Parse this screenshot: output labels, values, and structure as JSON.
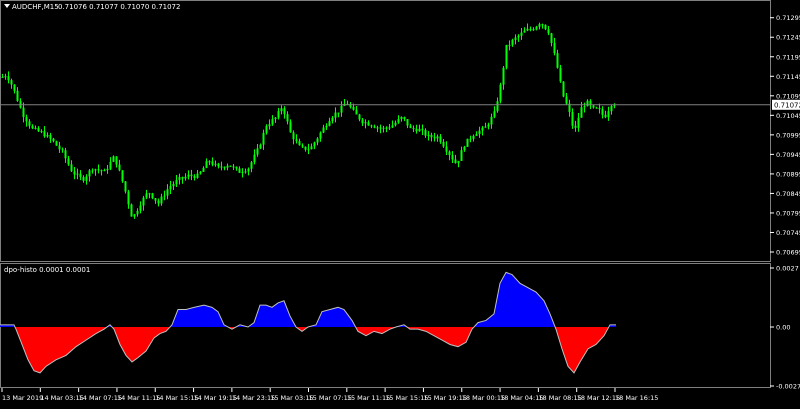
{
  "main_panel": {
    "symbol_label": "AUDCHF,M15",
    "ohlc_label": "0.71076 0.71077 0.71070 0.71072",
    "current_price": 0.71072,
    "price_tag": "0.71072",
    "y_range": [
      0.70695,
      0.71325
    ],
    "y_ticks": [
      "0.71295",
      "0.71245",
      "0.71195",
      "0.71145",
      "0.71095",
      "0.71045",
      "0.70995",
      "0.70945",
      "0.70895",
      "0.70845",
      "0.70795",
      "0.70745",
      "0.70695"
    ]
  },
  "indicator_panel": {
    "label": "dpo-histo 0.0001 0.0001",
    "y_ticks": [
      "0.0027",
      "0.00",
      "-0.0027"
    ],
    "y_range": [
      -0.0027,
      0.0027
    ],
    "positive_color": "#0000ff",
    "negative_color": "#ff0000",
    "line_color": "#c0c0c0"
  },
  "x_axis": {
    "labels": [
      "13 Mar 2019",
      "14 Mar 03:15",
      "14 Mar 07:15",
      "14 Mar 11:15",
      "14 Mar 15:15",
      "14 Mar 19:15",
      "14 Mar 23:15",
      "15 Mar 03:15",
      "15 Mar 07:15",
      "15 Mar 11:15",
      "15 Mar 15:15",
      "15 Mar 19:15",
      "18 Mar 00:15",
      "18 Mar 04:15",
      "18 Mar 08:15",
      "18 Mar 12:15",
      "18 Mar 16:15"
    ]
  },
  "colors": {
    "background": "#000000",
    "candle": "#00ff00",
    "axis_text": "#ffffff",
    "grid_line": "#808080"
  },
  "chart_data": [
    {
      "type": "candlestick",
      "title": "AUDCHF,M15",
      "ylim": [
        0.70695,
        0.71325
      ],
      "close_path": [
        [
          0,
          0.7114
        ],
        [
          6,
          0.7115
        ],
        [
          12,
          0.7112
        ],
        [
          22,
          0.7105
        ],
        [
          32,
          0.7101
        ],
        [
          42,
          0.71
        ],
        [
          52,
          0.7098
        ],
        [
          62,
          0.7095
        ],
        [
          72,
          0.709
        ],
        [
          82,
          0.7088
        ],
        [
          92,
          0.7091
        ],
        [
          104,
          0.709
        ],
        [
          114,
          0.7094
        ],
        [
          124,
          0.7086
        ],
        [
          132,
          0.7078
        ],
        [
          140,
          0.7082
        ],
        [
          148,
          0.7085
        ],
        [
          158,
          0.7082
        ],
        [
          168,
          0.7086
        ],
        [
          178,
          0.7088
        ],
        [
          188,
          0.7089
        ],
        [
          198,
          0.7089
        ],
        [
          208,
          0.7093
        ],
        [
          218,
          0.7091
        ],
        [
          228,
          0.7092
        ],
        [
          238,
          0.709
        ],
        [
          248,
          0.7091
        ],
        [
          258,
          0.7096
        ],
        [
          266,
          0.7102
        ],
        [
          276,
          0.7104
        ],
        [
          282,
          0.7107
        ],
        [
          290,
          0.71
        ],
        [
          300,
          0.7096
        ],
        [
          310,
          0.7096
        ],
        [
          320,
          0.71
        ],
        [
          330,
          0.7104
        ],
        [
          340,
          0.7106
        ],
        [
          346,
          0.7108
        ],
        [
          354,
          0.7105
        ],
        [
          362,
          0.7103
        ],
        [
          372,
          0.7102
        ],
        [
          382,
          0.7101
        ],
        [
          392,
          0.7102
        ],
        [
          402,
          0.7104
        ],
        [
          410,
          0.7101
        ],
        [
          418,
          0.7101
        ],
        [
          428,
          0.7099
        ],
        [
          438,
          0.7099
        ],
        [
          448,
          0.7095
        ],
        [
          456,
          0.7092
        ],
        [
          464,
          0.7097
        ],
        [
          474,
          0.71
        ],
        [
          484,
          0.7101
        ],
        [
          494,
          0.7105
        ],
        [
          500,
          0.7112
        ],
        [
          506,
          0.7122
        ],
        [
          514,
          0.7124
        ],
        [
          524,
          0.7126
        ],
        [
          534,
          0.7127
        ],
        [
          540,
          0.71285
        ],
        [
          548,
          0.7126
        ],
        [
          556,
          0.7118
        ],
        [
          562,
          0.711
        ],
        [
          568,
          0.7106
        ],
        [
          574,
          0.71
        ],
        [
          580,
          0.7106
        ],
        [
          586,
          0.7108
        ],
        [
          592,
          0.7106
        ],
        [
          598,
          0.7106
        ],
        [
          604,
          0.7104
        ],
        [
          612,
          0.7108
        ],
        [
          616,
          0.71072
        ]
      ]
    },
    {
      "type": "area",
      "title": "dpo-histo 0.0001 0.0001",
      "ylim": [
        -0.0027,
        0.0027
      ],
      "series_path": [
        [
          0,
          0.0001
        ],
        [
          14,
          0.0001
        ],
        [
          16,
          -0.0001
        ],
        [
          22,
          -0.0008
        ],
        [
          28,
          -0.0015
        ],
        [
          34,
          -0.002
        ],
        [
          40,
          -0.0021
        ],
        [
          46,
          -0.0018
        ],
        [
          56,
          -0.0015
        ],
        [
          66,
          -0.0013
        ],
        [
          76,
          -0.0009
        ],
        [
          86,
          -0.0006
        ],
        [
          96,
          -0.0003
        ],
        [
          104,
          -0.0001
        ],
        [
          110,
          0.0001
        ],
        [
          114,
          -0.0001
        ],
        [
          120,
          -0.0008
        ],
        [
          126,
          -0.0013
        ],
        [
          132,
          -0.0016
        ],
        [
          138,
          -0.0014
        ],
        [
          146,
          -0.0011
        ],
        [
          154,
          -0.0005
        ],
        [
          160,
          -0.0003
        ],
        [
          166,
          -0.0002
        ],
        [
          172,
          0.0001
        ],
        [
          178,
          0.0008
        ],
        [
          186,
          0.0008
        ],
        [
          194,
          0.0009
        ],
        [
          204,
          0.001
        ],
        [
          212,
          0.0009
        ],
        [
          218,
          0.0007
        ],
        [
          224,
          0.0001
        ],
        [
          232,
          -0.0001
        ],
        [
          240,
          0.0001
        ],
        [
          248,
          0.0
        ],
        [
          254,
          0.0002
        ],
        [
          260,
          0.001
        ],
        [
          266,
          0.001
        ],
        [
          272,
          0.0009
        ],
        [
          278,
          0.0011
        ],
        [
          284,
          0.0012
        ],
        [
          290,
          0.0005
        ],
        [
          296,
          0.0
        ],
        [
          302,
          -0.0002
        ],
        [
          308,
          0.0
        ],
        [
          316,
          0.0001
        ],
        [
          322,
          0.0007
        ],
        [
          330,
          0.0008
        ],
        [
          338,
          0.0009
        ],
        [
          344,
          0.0008
        ],
        [
          352,
          0.0003
        ],
        [
          358,
          -0.0002
        ],
        [
          366,
          -0.0004
        ],
        [
          374,
          -0.0002
        ],
        [
          382,
          -0.0003
        ],
        [
          390,
          -0.0001
        ],
        [
          396,
          0.0
        ],
        [
          404,
          0.0001
        ],
        [
          410,
          -0.0001
        ],
        [
          418,
          -0.0001
        ],
        [
          426,
          -0.0002
        ],
        [
          434,
          -0.0004
        ],
        [
          442,
          -0.0006
        ],
        [
          450,
          -0.0008
        ],
        [
          458,
          -0.0009
        ],
        [
          466,
          -0.0007
        ],
        [
          472,
          -0.0001
        ],
        [
          478,
          0.0002
        ],
        [
          486,
          0.0003
        ],
        [
          494,
          0.0006
        ],
        [
          500,
          0.002
        ],
        [
          506,
          0.0025
        ],
        [
          512,
          0.0024
        ],
        [
          520,
          0.002
        ],
        [
          528,
          0.0018
        ],
        [
          536,
          0.0016
        ],
        [
          544,
          0.0012
        ],
        [
          550,
          0.0006
        ],
        [
          556,
          -0.0001
        ],
        [
          562,
          -0.001
        ],
        [
          568,
          -0.0018
        ],
        [
          574,
          -0.0021
        ],
        [
          580,
          -0.0016
        ],
        [
          588,
          -0.001
        ],
        [
          596,
          -0.0008
        ],
        [
          604,
          -0.0004
        ],
        [
          610,
          0.0001
        ],
        [
          616,
          0.0001
        ]
      ]
    }
  ]
}
